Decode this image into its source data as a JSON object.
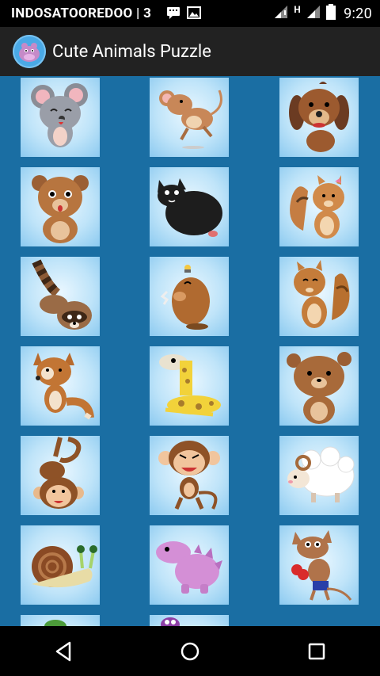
{
  "status_bar": {
    "carrier": "INDOSATOOREDOO | 3",
    "network_type": "H",
    "time": "9:20",
    "icons": [
      "chat-notification-icon",
      "image-notification-icon",
      "signal-1-icon",
      "signal-2-icon",
      "battery-icon"
    ]
  },
  "app_bar": {
    "title": "Cute Animals Puzzle",
    "logo_icon": "hippo-icon"
  },
  "puzzles": [
    {
      "name": "mouse"
    },
    {
      "name": "running-mouse"
    },
    {
      "name": "puppy"
    },
    {
      "name": "bear-cub"
    },
    {
      "name": "black-cat"
    },
    {
      "name": "chipmunk-with-bow"
    },
    {
      "name": "raccoon"
    },
    {
      "name": "mole"
    },
    {
      "name": "squirrel"
    },
    {
      "name": "fox"
    },
    {
      "name": "giraffe"
    },
    {
      "name": "teddy-bear"
    },
    {
      "name": "monkey-hanging"
    },
    {
      "name": "monkey-standing"
    },
    {
      "name": "sheep"
    },
    {
      "name": "snail"
    },
    {
      "name": "pink-dinosaur"
    },
    {
      "name": "boxing-rat"
    },
    {
      "name": "frog-partial"
    },
    {
      "name": "purple-animal-partial"
    }
  ],
  "nav_bar": {
    "icons": [
      "back-icon",
      "home-icon",
      "recents-icon"
    ]
  },
  "colors": {
    "background": "#1a6ea3",
    "app_bar": "#222222",
    "status_bar": "#000000",
    "tile": "#bfe4f9"
  }
}
